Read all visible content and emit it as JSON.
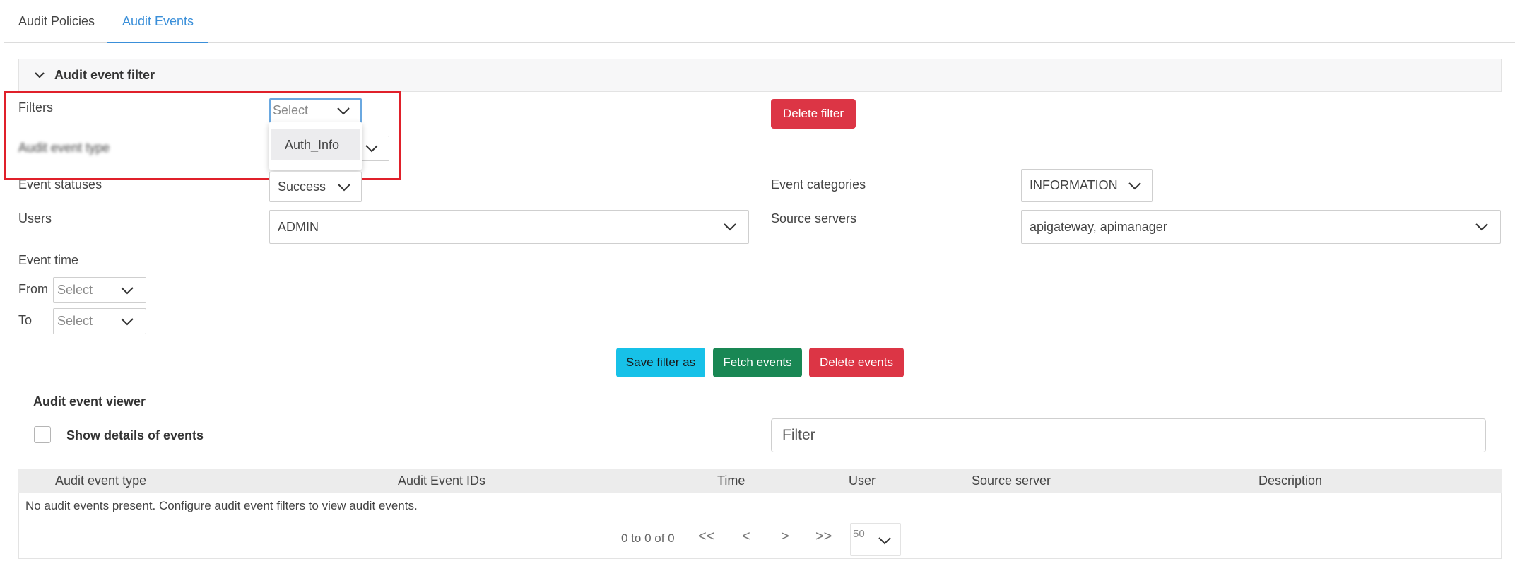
{
  "tabs": [
    {
      "label": "Audit Policies"
    },
    {
      "label": "Audit Events"
    }
  ],
  "filter_panel": {
    "title": "Audit event filter",
    "filters": {
      "label": "Filters",
      "placeholder": "Select",
      "options": [
        "Auth_Info"
      ]
    },
    "audit_event_type": {
      "label": "Audit event type"
    },
    "delete_filter_label": "Delete filter",
    "event_statuses": {
      "label": "Event statuses",
      "value": "Success"
    },
    "event_categories": {
      "label": "Event categories",
      "value": "INFORMATION"
    },
    "users": {
      "label": "Users",
      "value": "ADMIN"
    },
    "source_servers": {
      "label": "Source servers",
      "value": "apigateway, apimanager"
    },
    "event_time": {
      "label": "Event time",
      "from": {
        "label": "From",
        "placeholder": "Select"
      },
      "to": {
        "label": "To",
        "placeholder": "Select"
      }
    },
    "buttons": {
      "save": "Save filter as",
      "fetch": "Fetch events",
      "delete": "Delete events"
    }
  },
  "viewer": {
    "title": "Audit event viewer",
    "show_details_label": "Show details of events",
    "filter_placeholder": "Filter",
    "columns": [
      "Audit event type",
      "Audit Event IDs",
      "Time",
      "User",
      "Source server",
      "Description"
    ],
    "empty_message": "No audit events present. Configure audit event filters to view audit events.",
    "pagination": {
      "summary": "0 to 0 of 0",
      "first": "<<",
      "prev": "<",
      "next": ">",
      "last": ">>",
      "page_size": "50"
    }
  },
  "colors": {
    "accent": "#3a8fd9",
    "danger": "#dc3545",
    "info": "#17c1e8",
    "success": "#198754",
    "highlight": "#e0202a"
  }
}
